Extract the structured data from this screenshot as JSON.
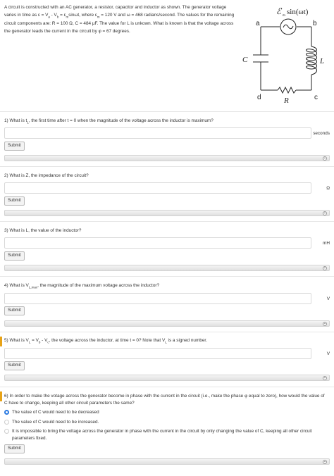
{
  "intro": {
    "p1": "A circuit is constructed with an AC generator, a resistor, capacitor and inductor as shown. The generator voltage varies in time as ε = V",
    "p1b": " - V",
    "p1c": " = ε",
    "p1d": "sinωt, where ε",
    "p1e": " = 120 V and ω = 468 radians/second. The values for the remaining circuit components are: R = 100 Ω, C = 484 μF. The value for L is unkown. What is known is that the voltage across the generator leads the current in the circuit by φ = 67 degrees.",
    "sub_a": "a",
    "sub_b": "b",
    "sub_m": "m"
  },
  "circuit": {
    "emf_label": "ℰ",
    "emf_sub": "m",
    "emf_func": "sin(ωt)",
    "node_a": "a",
    "node_b": "b",
    "node_c": "c",
    "node_d": "d",
    "label_C": "C",
    "label_L": "L",
    "label_R": "R"
  },
  "questions": [
    {
      "text_pre": "1) What is t",
      "sub": "1",
      "text_post": ", the first time after t = 0 when the magnitude of the voltage across the inductor is maximum?",
      "unit": "seconds"
    },
    {
      "text_pre": "2) What is Z, the impedance of the circuit?",
      "unit": "Ω"
    },
    {
      "text_pre": "3) What is L, the value of the inductor?",
      "unit": "mH"
    },
    {
      "text_pre": "4) What is V",
      "sub": "L,max",
      "text_post": ", the magnitude of the maximum voltage across the inductor?",
      "unit": "V"
    },
    {
      "text_pre": "5) What is V",
      "sub": "L",
      "text_post": " = V",
      "sub2": "b",
      "text_post2": " - V",
      "sub3": "c",
      "text_post3": ", the voltage across the inductor, at time t = 0? Note that V",
      "sub4": "L",
      "text_post4": " is a signed number.",
      "unit": "V"
    },
    {
      "text_pre": "6) In order to make the votage across the generator become in phase with the current in the circuit (i.e., make the phase φ equal to zero), how would the value of C have to change, keeping all other circuit parameters the same?"
    }
  ],
  "options": [
    {
      "label": "The value of C would need to be decreased",
      "selected": true
    },
    {
      "label": "The value of C would need to be increased.",
      "selected": false
    },
    {
      "label": "It is impossible to bring the voltage across the generator in phase with the current in the circuit by only changing the value of C, keeping all other circuit parameters fixed.",
      "selected": false
    }
  ],
  "submit_label": "Submit",
  "plus_glyph": "+",
  "colors": {
    "accent": "#2a7ae2",
    "marker": "#e8a317"
  }
}
